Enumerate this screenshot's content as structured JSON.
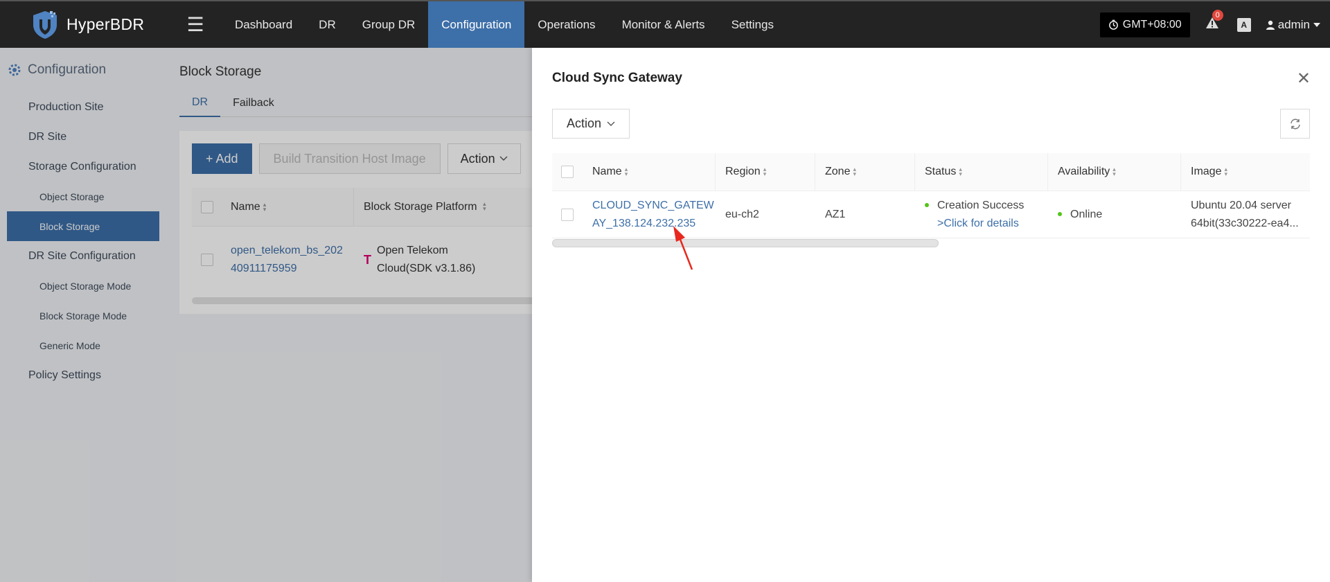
{
  "app": {
    "name": "HyperBDR"
  },
  "nav": {
    "items": [
      "Dashboard",
      "DR",
      "Group DR",
      "Configuration",
      "Operations",
      "Monitor & Alerts",
      "Settings"
    ],
    "active": "Configuration"
  },
  "topbar": {
    "timezone": "GMT+08:00",
    "alert_count": "0",
    "user": "admin",
    "lang_icon": "A"
  },
  "sidebar": {
    "title": "Configuration",
    "items": {
      "production_site": "Production Site",
      "dr_site": "DR Site",
      "storage_configuration": "Storage Configuration",
      "object_storage": "Object Storage",
      "block_storage": "Block Storage",
      "dr_site_configuration": "DR Site Configuration",
      "object_storage_mode": "Object Storage Mode",
      "block_storage_mode": "Block Storage Mode",
      "generic_mode": "Generic Mode",
      "policy_settings": "Policy Settings"
    }
  },
  "main": {
    "title": "Block Storage",
    "tabs": [
      "DR",
      "Failback"
    ],
    "buttons": {
      "add": "+ Add",
      "build_image": "Build Transition Host Image",
      "action": "Action"
    },
    "table": {
      "headers": {
        "name": "Name",
        "platform": "Block Storage Platform"
      },
      "rows": [
        {
          "name_line1": "open_telekom_bs_202",
          "name_line2": "40911175959",
          "platform_line1": "Open Telekom",
          "platform_line2": "Cloud(SDK v3.1.86)",
          "platform_icon": "T"
        }
      ]
    }
  },
  "drawer": {
    "title": "Cloud Sync Gateway",
    "action_label": "Action",
    "table": {
      "headers": {
        "name": "Name",
        "region": "Region",
        "zone": "Zone",
        "status": "Status",
        "availability": "Availability",
        "image": "Image"
      },
      "rows": [
        {
          "name_line1": "CLOUD_SYNC_GATEW",
          "name_line2": "AY_138.124.232.235",
          "region": "eu-ch2",
          "zone": "AZ1",
          "status": "Creation Success",
          "status_link": ">Click for details",
          "availability": "Online",
          "image_line1": "Ubuntu 20.04 server",
          "image_line2": "64bit(33c30222-ea4..."
        }
      ]
    }
  },
  "colors": {
    "accent": "#3d6fa8",
    "topbar": "#232323",
    "online": "#52c41a",
    "arrow": "#e8281e"
  },
  "icons": [
    "shield-logo-icon",
    "hamburger-icon",
    "clock-icon",
    "warning-icon",
    "translate-icon",
    "user-icon",
    "gear-icon",
    "sort-icon",
    "close-icon",
    "refresh-icon",
    "chevron-down-icon",
    "telekom-icon"
  ]
}
